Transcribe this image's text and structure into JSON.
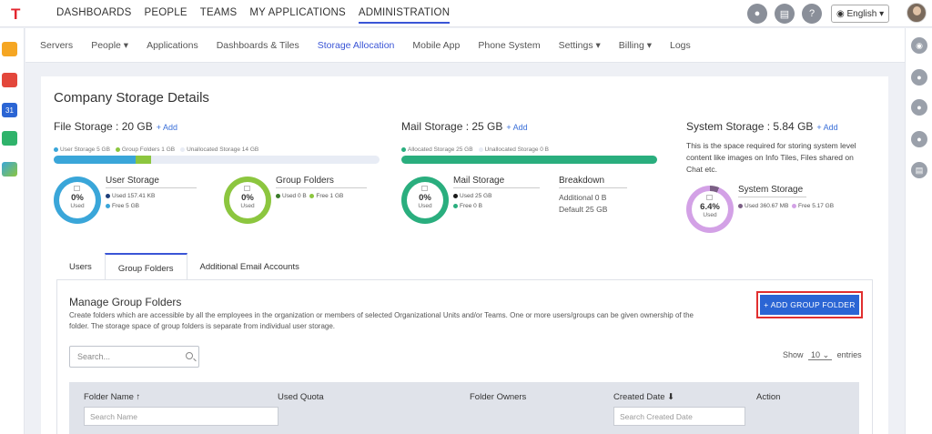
{
  "app": {
    "logo": "T"
  },
  "topnav": {
    "items": [
      "DASHBOARDS",
      "PEOPLE",
      "TEAMS",
      "MY APPLICATIONS",
      "ADMINISTRATION"
    ],
    "active": "ADMINISTRATION",
    "help": "?",
    "language": "English"
  },
  "subnav": {
    "items": [
      "Servers",
      "People ▾",
      "Applications",
      "Dashboards & Tiles",
      "Storage Allocation",
      "Mobile App",
      "Phone System",
      "Settings ▾",
      "Billing ▾",
      "Logs"
    ],
    "active": "Storage Allocation"
  },
  "page": {
    "title": "Company Storage Details"
  },
  "file_storage": {
    "title": "File Storage : 20 GB",
    "add": "+ Add",
    "legend": [
      "User Storage 5 GB",
      "Group Folders 1 GB",
      "Unallocated Storage 14 GB"
    ],
    "colors": {
      "user": "#3aa6d9",
      "group": "#8cc63f",
      "unallocated": "#e8ecf5"
    },
    "fractions": {
      "user": 0.25,
      "group": 0.05
    },
    "user": {
      "title": "User Storage",
      "pct": "0%",
      "used_label": "Used",
      "used": "Used 157.41 KB",
      "free": "Free 5 GB"
    },
    "group": {
      "title": "Group Folders",
      "pct": "0%",
      "used_label": "Used",
      "used": "Used 0 B",
      "free": "Free 1 GB"
    }
  },
  "mail_storage": {
    "title": "Mail Storage : 25 GB",
    "add": "+ Add",
    "legend": [
      "Allocated Storage 25 GB",
      "Unallocated Storage 0 B"
    ],
    "colors": {
      "allocated": "#2aae7e",
      "used": "#1a1a1a"
    },
    "fractions": {
      "allocated": 1.0
    },
    "mail": {
      "title": "Mail Storage",
      "pct": "0%",
      "used_label": "Used",
      "used": "Used 25 GB",
      "free": "Free 0 B"
    },
    "breakdown": {
      "title": "Breakdown",
      "additional": "Additional 0 B",
      "default": "Default 25 GB"
    }
  },
  "system_storage": {
    "title": "System Storage : 5.84 GB",
    "add": "+ Add",
    "description": "This is the space required for storing system level content like images on Info Tiles, Files shared on Chat etc.",
    "colors": {
      "used": "#7b5f85",
      "free": "#d3a1e6"
    },
    "system": {
      "title": "System Storage",
      "pct": "6.4%",
      "pct_value": 6.4,
      "used_label": "Used",
      "used": "Used 360.67 MB",
      "free": "Free 5.17 GB"
    }
  },
  "tabs": {
    "items": [
      "Users",
      "Group Folders",
      "Additional Email Accounts"
    ],
    "active": "Group Folders"
  },
  "group_folders": {
    "title": "Manage Group Folders",
    "description": "Create folders which are accessible by all the employees in the organization or members of selected Organizational Units and/or Teams. One or more users/groups can be given ownership of the folder. The storage space of group folders is separate from individual user storage.",
    "add_button": "+ ADD GROUP FOLDER",
    "search_placeholder": "Search...",
    "show_label": "Show",
    "show_value": "10",
    "entries_label": "entries",
    "columns": [
      "Folder Name ↑",
      "Used Quota",
      "Folder Owners",
      "Created Date ⬇",
      "Action"
    ],
    "filter_name_placeholder": "Search Name",
    "filter_date_placeholder": "Search Created Date"
  }
}
